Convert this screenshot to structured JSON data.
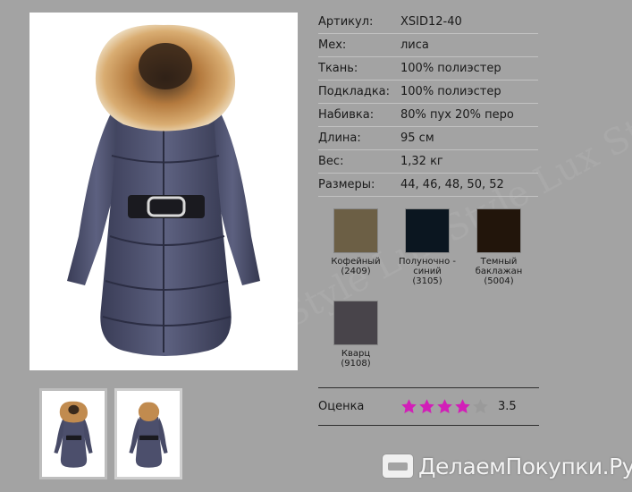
{
  "specs": [
    {
      "label": "Артикул:",
      "value": "XSID12-40"
    },
    {
      "label": "Мех:",
      "value": "лиса"
    },
    {
      "label": "Ткань:",
      "value": "100% полиэстер"
    },
    {
      "label": "Подкладка:",
      "value": "100% полиэстер"
    },
    {
      "label": "Набивка:",
      "value": "80% пух 20% перо"
    },
    {
      "label": "Длина:",
      "value": "95 см"
    },
    {
      "label": "Вес:",
      "value": "1,32 кг"
    },
    {
      "label": "Размеры:",
      "value": "44, 46, 48, 50, 52"
    }
  ],
  "colors": [
    {
      "name": "Кофейный\n(2409)",
      "hex": "#6c5f45"
    },
    {
      "name": "Полуночно -\nсиний\n(3105)",
      "hex": "#0b1620"
    },
    {
      "name": "Темный\nбаклажан\n(5004)",
      "hex": "#22150b"
    },
    {
      "name": "Кварц\n(9108)",
      "hex": "#48444a"
    }
  ],
  "rating": {
    "label": "Оценка",
    "value": "3.5",
    "stars_filled": 4,
    "stars_total": 5,
    "star_color": "#d21fb8",
    "star_empty_color": "#9a9a9a"
  },
  "brand": {
    "text": "ДелаемПокупки.Ру"
  },
  "watermark": {
    "text": "Style Lux\nStyle Lux\nStyle Lux"
  },
  "images": {
    "main": "coat-front-icon",
    "thumbs": [
      "coat-front-thumb",
      "coat-back-thumb"
    ]
  }
}
